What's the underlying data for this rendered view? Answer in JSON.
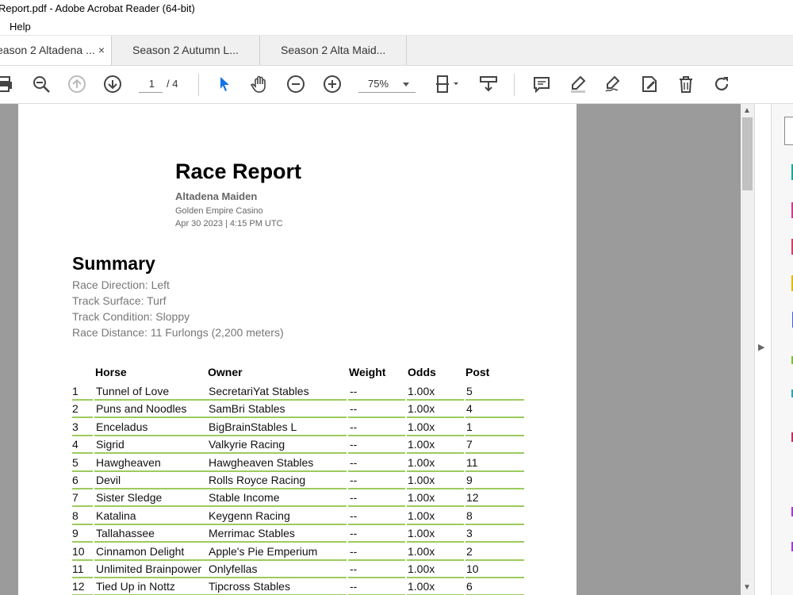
{
  "window": {
    "title": "Report.pdf - Adobe Acrobat Reader (64-bit)"
  },
  "menu": {
    "help": "Help"
  },
  "tabs": [
    {
      "label": "eason 2 Altadena ...",
      "active": true,
      "close": "×"
    },
    {
      "label": "Season 2 Autumn L...",
      "active": false
    },
    {
      "label": "Season 2 Alta Maid...",
      "active": false
    }
  ],
  "toolbar": {
    "page_current": "1",
    "page_total": "/ 4",
    "zoom": "75%"
  },
  "document": {
    "title": "Race Report",
    "race_name": "Altadena Maiden",
    "venue": "Golden Empire Casino",
    "date": "Apr 30 2023 | 4:15 PM UTC",
    "summary": {
      "heading": "Summary",
      "direction": "Race Direction: Left",
      "surface": "Track Surface: Turf",
      "condition": "Track Condition: Sloppy",
      "distance": "Race Distance: 11 Furlongs (2,200 meters)"
    },
    "table": {
      "headers": {
        "horse": "Horse",
        "owner": "Owner",
        "weight": "Weight",
        "odds": "Odds",
        "post": "Post"
      },
      "rows": [
        {
          "pos": "1",
          "horse": "Tunnel of Love",
          "owner": "SecretariYat Stables",
          "weight": "--",
          "odds": "1.00x",
          "post": "5"
        },
        {
          "pos": "2",
          "horse": "Puns and Noodles",
          "owner": "SamBri Stables",
          "weight": "--",
          "odds": "1.00x",
          "post": "4"
        },
        {
          "pos": "3",
          "horse": "Enceladus",
          "owner": "BigBrainStables L",
          "weight": "--",
          "odds": "1.00x",
          "post": "1"
        },
        {
          "pos": "4",
          "horse": "Sigrid",
          "owner": "Valkyrie Racing",
          "weight": "--",
          "odds": "1.00x",
          "post": "7"
        },
        {
          "pos": "5",
          "horse": "Hawgheaven",
          "owner": "Hawgheaven Stables",
          "weight": "--",
          "odds": "1.00x",
          "post": "11"
        },
        {
          "pos": "6",
          "horse": "Devil",
          "owner": "Rolls Royce Racing",
          "weight": "--",
          "odds": "1.00x",
          "post": "9"
        },
        {
          "pos": "7",
          "horse": "Sister Sledge",
          "owner": "Stable Income",
          "weight": "--",
          "odds": "1.00x",
          "post": "12"
        },
        {
          "pos": "8",
          "horse": "Katalina",
          "owner": "Keygenn Racing",
          "weight": "--",
          "odds": "1.00x",
          "post": "8"
        },
        {
          "pos": "9",
          "horse": "Tallahassee",
          "owner": "Merrimac Stables",
          "weight": "--",
          "odds": "1.00x",
          "post": "3"
        },
        {
          "pos": "10",
          "horse": "Cinnamon Delight",
          "owner": "Apple's Pie Emperium",
          "weight": "--",
          "odds": "1.00x",
          "post": "2"
        },
        {
          "pos": "11",
          "horse": "Unlimited Brainpower",
          "owner": "Onlyfellas",
          "weight": "--",
          "odds": "1.00x",
          "post": "10"
        },
        {
          "pos": "12",
          "horse": "Tied Up in Nottz",
          "owner": "Tipcross Stables",
          "weight": "--",
          "odds": "1.00x",
          "post": "6"
        }
      ]
    }
  },
  "colors": {
    "accent": "#1473e6",
    "row_underline": "#9ccb5e",
    "viewer_bg": "#9b9b9b"
  }
}
